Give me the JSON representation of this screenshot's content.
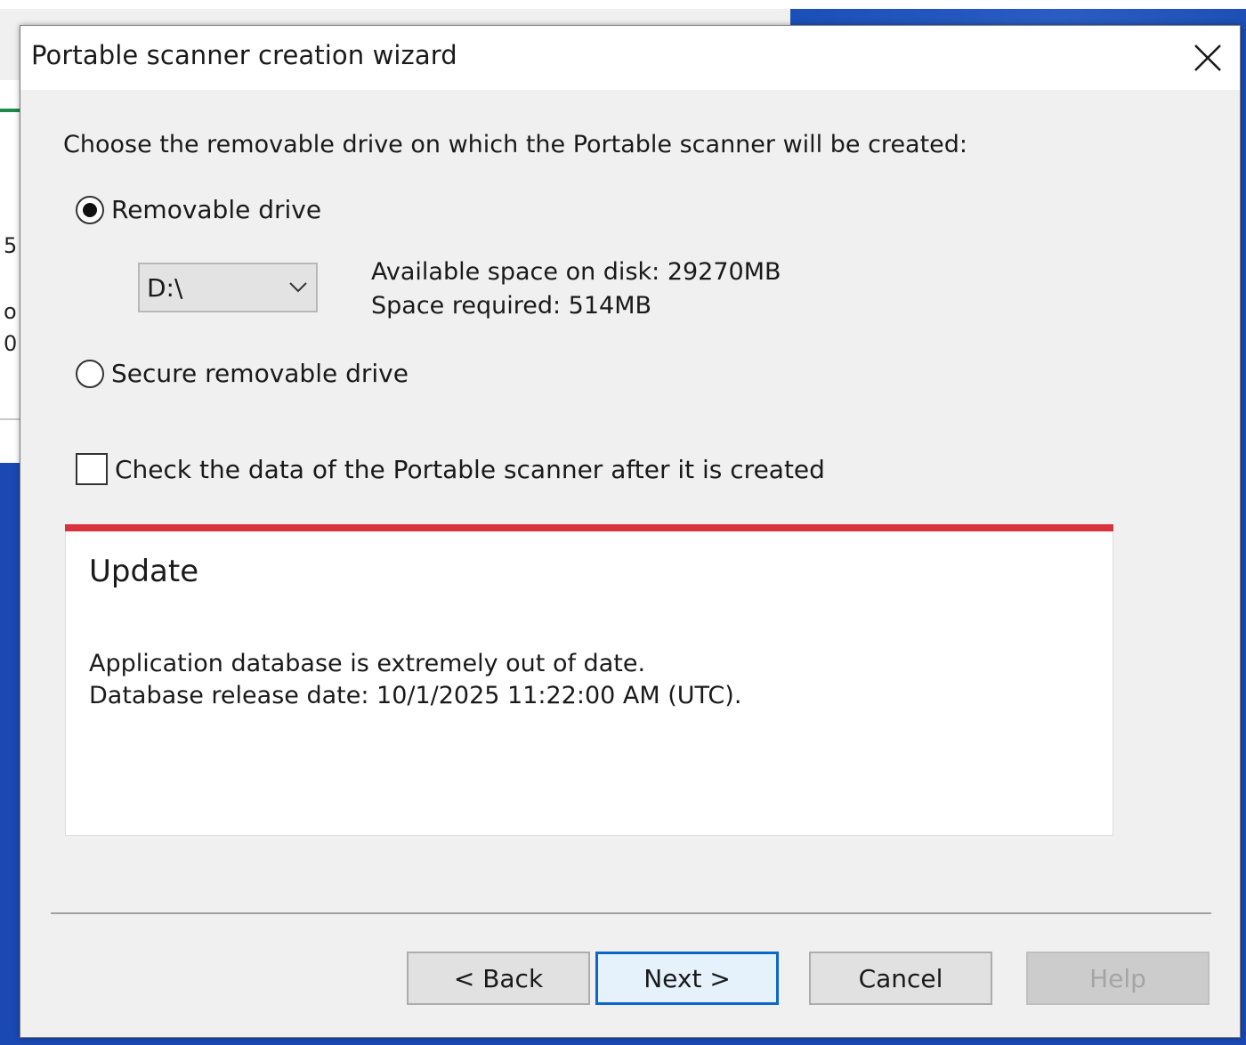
{
  "background": {
    "partial_chars": [
      "5",
      "o",
      "0"
    ]
  },
  "dialog": {
    "title": "Portable scanner creation wizard",
    "close_icon": "close-icon",
    "instruction": "Choose the removable drive on which the Portable scanner will be created:",
    "options": {
      "removable_drive": {
        "label": "Removable drive",
        "selected": true
      },
      "secure_removable_drive": {
        "label": "Secure removable drive",
        "selected": false
      }
    },
    "drive_select": {
      "value": "D:\\",
      "icon": "chevron-down-icon"
    },
    "space": {
      "available": "Available space on disk: 29270MB",
      "required": "Space required: 514MB"
    },
    "check_data": {
      "label": "Check the data of the Portable scanner after it is created",
      "checked": false
    },
    "update": {
      "title": "Update",
      "line1": "Application database is extremely out of date.",
      "line2": "Database release date: 10/1/2025 11:22:00 AM (UTC).",
      "accent_color": "#d8323c"
    },
    "buttons": {
      "back": "< Back",
      "next": "Next >",
      "cancel": "Cancel",
      "help": "Help"
    }
  }
}
